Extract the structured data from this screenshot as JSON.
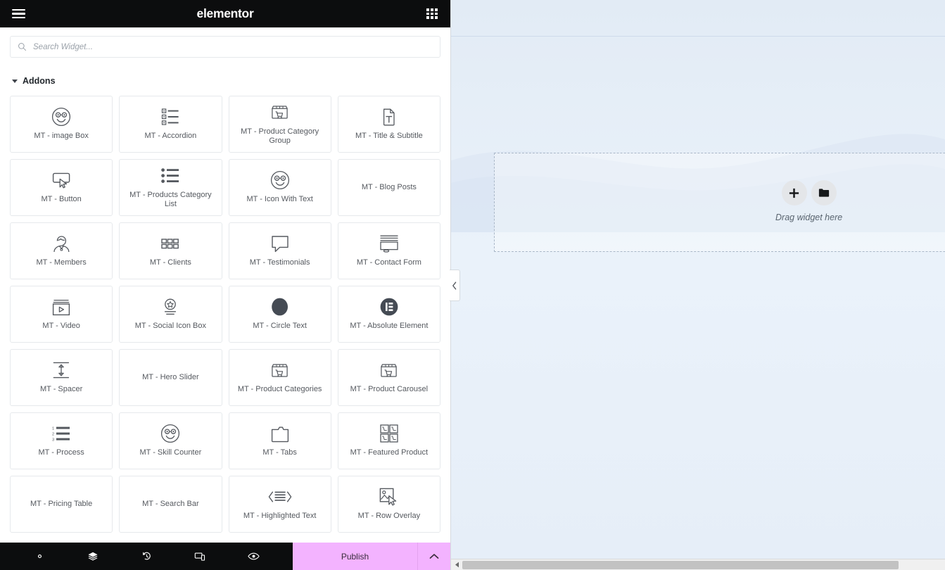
{
  "header": {
    "brand": "elementor",
    "menu_icon": "hamburger-menu-icon",
    "apps_icon": "apps-grid-icon"
  },
  "search": {
    "placeholder": "Search Widget...",
    "value": "",
    "icon": "search-icon"
  },
  "panel": {
    "section_title": "Addons",
    "collapse_handle_icon": "chevron-left-icon",
    "widgets": [
      {
        "label": "MT - image Box",
        "icon": "smiley-glasses-icon"
      },
      {
        "label": "MT - Accordion",
        "icon": "accordion-list-icon"
      },
      {
        "label": "MT - Product Category Group",
        "icon": "storefront-cart-icon"
      },
      {
        "label": "MT - Title & Subtitle",
        "icon": "document-text-icon"
      },
      {
        "label": "MT - Button",
        "icon": "button-cursor-icon"
      },
      {
        "label": "MT - Products Category List",
        "icon": "bullet-list-icon"
      },
      {
        "label": "MT - Icon With Text",
        "icon": "smiley-glasses-icon"
      },
      {
        "label": "MT - Blog Posts",
        "icon": "none"
      },
      {
        "label": "MT - Members",
        "icon": "person-icon"
      },
      {
        "label": "MT - Clients",
        "icon": "grid-blocks-icon"
      },
      {
        "label": "MT - Testimonials",
        "icon": "speech-bubble-icon"
      },
      {
        "label": "MT - Contact Form",
        "icon": "contact-form-icon"
      },
      {
        "label": "MT - Video",
        "icon": "video-play-icon"
      },
      {
        "label": "MT - Social Icon Box",
        "icon": "star-badge-icon"
      },
      {
        "label": "MT - Circle Text",
        "icon": "filled-circle-icon"
      },
      {
        "label": "MT - Absolute Element",
        "icon": "elementor-logo-icon"
      },
      {
        "label": "MT - Spacer",
        "icon": "vertical-arrows-icon"
      },
      {
        "label": "MT - Hero Slider",
        "icon": "none"
      },
      {
        "label": "MT - Product Categories",
        "icon": "storefront-cart-icon"
      },
      {
        "label": "MT - Product Carousel",
        "icon": "storefront-cart-icon"
      },
      {
        "label": "MT - Process",
        "icon": "numbered-list-icon"
      },
      {
        "label": "MT - Skill Counter",
        "icon": "smiley-glasses-icon"
      },
      {
        "label": "MT - Tabs",
        "icon": "folder-tabs-icon"
      },
      {
        "label": "MT - Featured Product",
        "icon": "cart-grid-icon"
      },
      {
        "label": "MT - Pricing Table",
        "icon": "none"
      },
      {
        "label": "MT - Search Bar",
        "icon": "none"
      },
      {
        "label": "MT - Highlighted Text",
        "icon": "angle-brackets-text-icon"
      },
      {
        "label": "MT - Row Overlay",
        "icon": "image-cursor-icon"
      }
    ]
  },
  "footer": {
    "tools": [
      {
        "name": "settings",
        "icon": "gear-icon"
      },
      {
        "name": "navigator",
        "icon": "layers-icon"
      },
      {
        "name": "history",
        "icon": "history-clock-icon"
      },
      {
        "name": "responsive",
        "icon": "responsive-devices-icon"
      },
      {
        "name": "preview",
        "icon": "eye-icon"
      }
    ],
    "publish_label": "Publish",
    "publish_more_icon": "chevron-up-icon",
    "publish_color": "#f3b3ff"
  },
  "canvas": {
    "dropzone_text": "Drag widget here",
    "add_icon": "plus-icon",
    "folder_icon": "folder-icon",
    "scroll_left_icon": "triangle-left-icon"
  },
  "colors": {
    "header_bg": "#0c0d0e",
    "panel_bg": "#ffffff",
    "card_border": "#e6e9ec",
    "text": "#55595f",
    "canvas_bg": "#e6eef8",
    "accent": "#f3b3ff"
  }
}
